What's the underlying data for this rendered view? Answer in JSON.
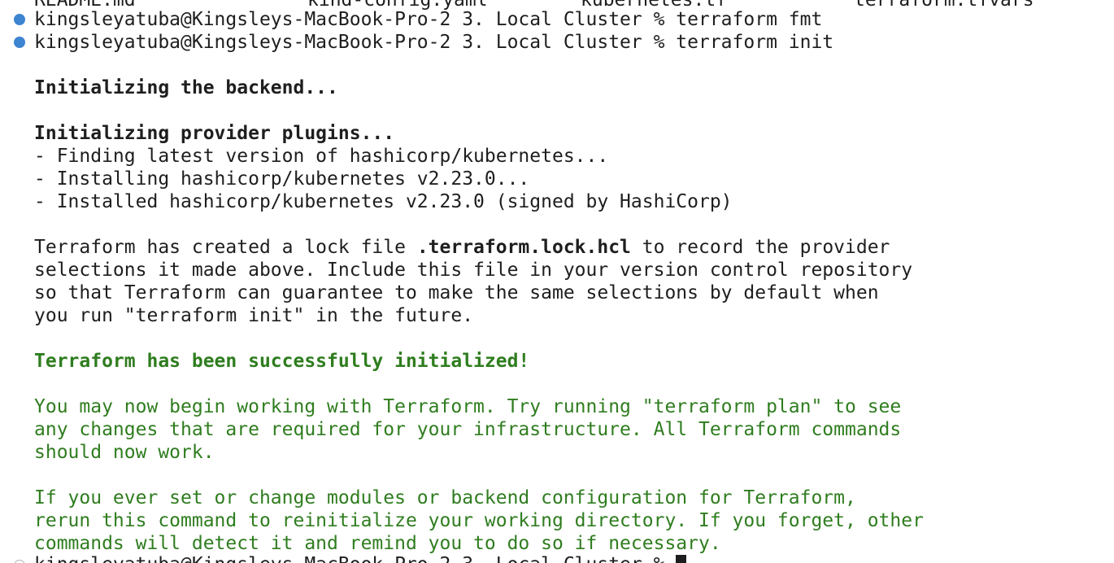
{
  "colors": {
    "background": "#ffffff",
    "text": "#1e1e1e",
    "success_green": "#2f7d1f",
    "prompt_dot": "#3d84d1"
  },
  "top_partial_row": [
    "README.md",
    "kind-config.yaml",
    "kubernetes.tf",
    "terraform.tfvars"
  ],
  "prompt": "kingsleyatuba@Kingsleys-MacBook-Pro-2 3. Local Cluster % ",
  "commands": {
    "fmt": "terraform fmt",
    "init": "terraform init"
  },
  "output": {
    "backend": "Initializing the backend...",
    "providers_heading": "Initializing provider plugins...",
    "finding": "- Finding latest version of hashicorp/kubernetes...",
    "installing": "- Installing hashicorp/kubernetes v2.23.0...",
    "installed": "- Installed hashicorp/kubernetes v2.23.0 (signed by HashiCorp)",
    "lock_pre": "Terraform has created a lock file ",
    "lock_file": ".terraform.lock.hcl",
    "lock_post": " to record the provider",
    "lock_line2": "selections it made above. Include this file in your version control repository",
    "lock_line3": "so that Terraform can guarantee to make the same selections by default when",
    "lock_line4": "you run \"terraform init\" in the future.",
    "success": "Terraform has been successfully initialized!",
    "working1": "You may now begin working with Terraform. Try running \"terraform plan\" to see",
    "working2": "any changes that are required for your infrastructure. All Terraform commands",
    "working3": "should now work.",
    "rerun1": "If you ever set or change modules or backend configuration for Terraform,",
    "rerun2": "rerun this command to reinitialize your working directory. If you forget, other",
    "rerun3": "commands will detect it and remind you to do so if necessary."
  }
}
